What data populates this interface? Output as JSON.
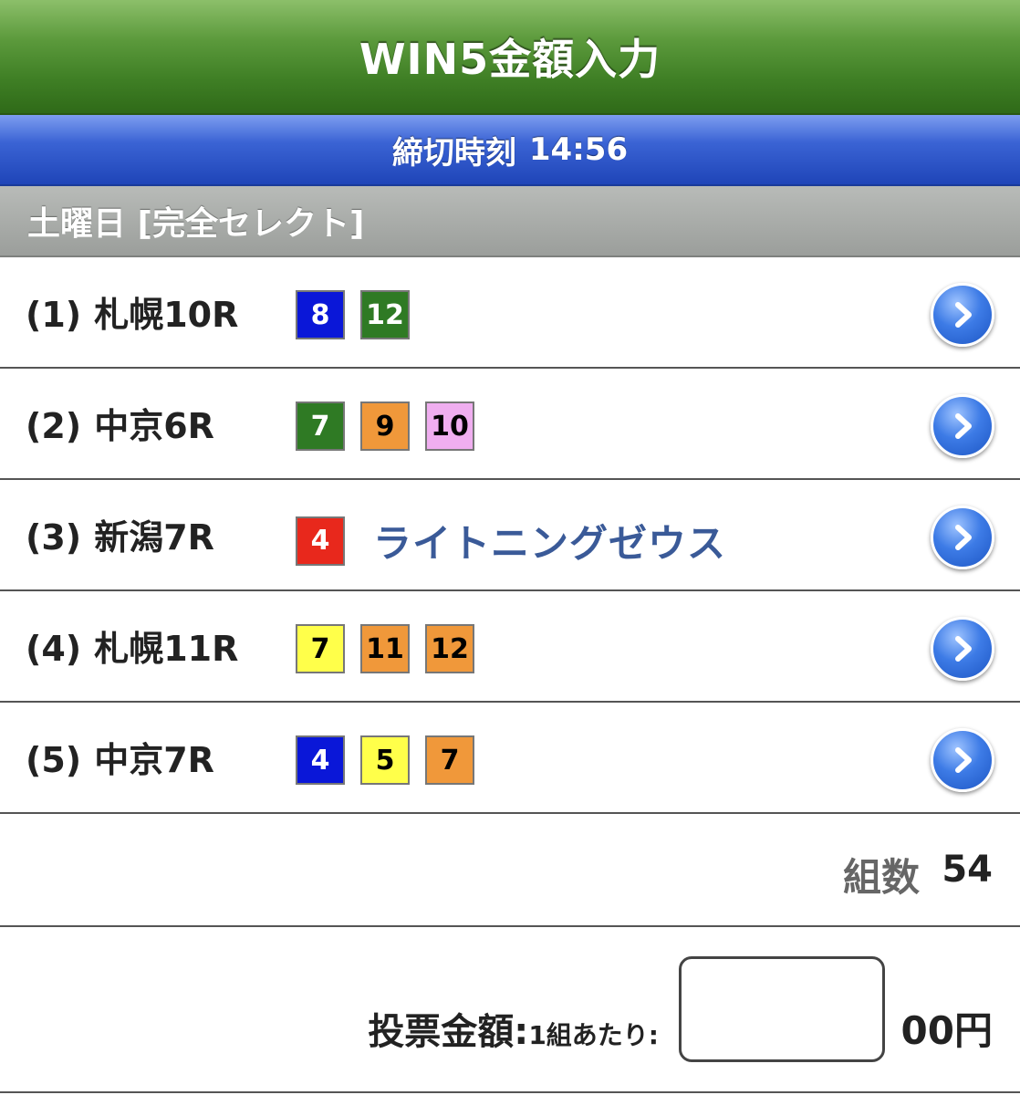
{
  "header": {
    "title": "WIN5金額入力"
  },
  "deadline": {
    "label": "締切時刻",
    "time": "14:56"
  },
  "day_header": "土曜日 [完全セレクト]",
  "races": [
    {
      "num": "(1)",
      "name": "札幌10R",
      "picks": [
        {
          "text": "8",
          "bg": "#0a17d8",
          "fg": "#ffffff"
        },
        {
          "text": "12",
          "bg": "#2f7a24",
          "fg": "#ffffff"
        }
      ],
      "horse": ""
    },
    {
      "num": "(2)",
      "name": "中京6R",
      "picks": [
        {
          "text": "7",
          "bg": "#2f7a24",
          "fg": "#ffffff"
        },
        {
          "text": "9",
          "bg": "#f0983a",
          "fg": "#000000"
        },
        {
          "text": "10",
          "bg": "#f0aef0",
          "fg": "#000000"
        }
      ],
      "horse": ""
    },
    {
      "num": "(3)",
      "name": "新潟7R",
      "picks": [
        {
          "text": "4",
          "bg": "#e8281c",
          "fg": "#ffffff"
        }
      ],
      "horse": "ライトニングゼウス"
    },
    {
      "num": "(4)",
      "name": "札幌11R",
      "picks": [
        {
          "text": "7",
          "bg": "#ffff4a",
          "fg": "#000000"
        },
        {
          "text": "11",
          "bg": "#f0983a",
          "fg": "#000000"
        },
        {
          "text": "12",
          "bg": "#f0983a",
          "fg": "#000000"
        }
      ],
      "horse": ""
    },
    {
      "num": "(5)",
      "name": "中京7R",
      "picks": [
        {
          "text": "4",
          "bg": "#0a17d8",
          "fg": "#ffffff"
        },
        {
          "text": "5",
          "bg": "#ffff4a",
          "fg": "#000000"
        },
        {
          "text": "7",
          "bg": "#f0983a",
          "fg": "#000000"
        }
      ],
      "horse": ""
    }
  ],
  "combo": {
    "label": "組数",
    "value": "54"
  },
  "amount": {
    "label": "投票金額:",
    "sublabel": "1組あたり:",
    "value": "",
    "unit": "00円"
  },
  "icons": {
    "row_action": "chevron-right-circle-icon"
  }
}
